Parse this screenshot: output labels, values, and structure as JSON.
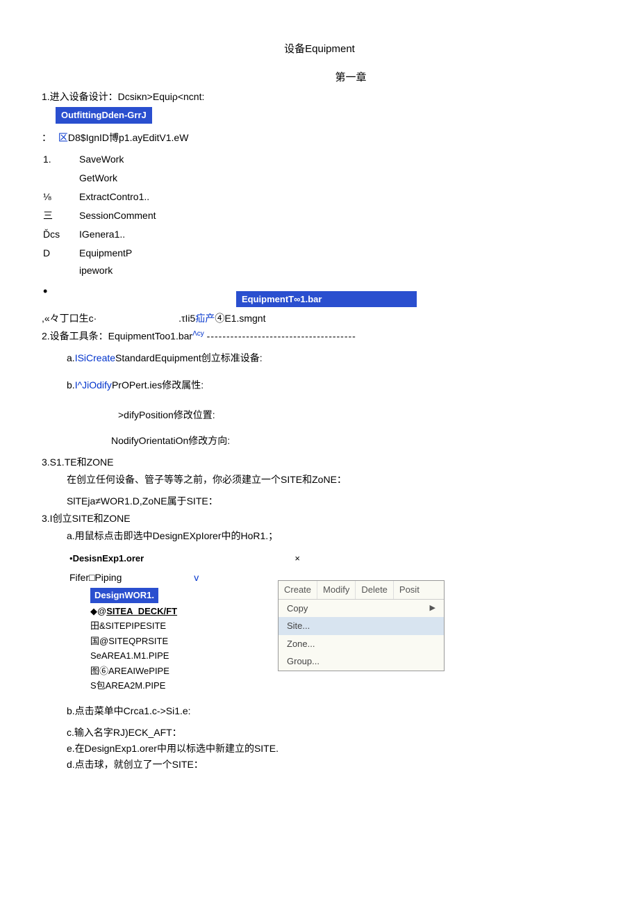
{
  "title": "设备Equipment",
  "chapter": "第一章",
  "step1": "1.进入设备设计：Dcsiκn>Equiρ<ncnt:",
  "box_outfitting": "OutfittingDden-GrrJ",
  "line_colon": "：",
  "line_area": "区",
  "line_d8": "D8$IgnID博p1.ayEditV1.eW",
  "left_col": {
    "r1": "1.",
    "r2": "⅛",
    "r3": "三",
    "r4": "Ďcs",
    "r5": "D",
    "r6": "•"
  },
  "right_col": {
    "r1a": "SaveWork",
    "r1b": "GetWork",
    "r2": "ExtractContro1..",
    "r3": "SessionComment",
    "r4": "IGenera1..",
    "r5a": "EquipmentP",
    "r5b": "ipework"
  },
  "box_toolbar": "EquipmentT∞1.bar",
  "line_cc": ",«々丁口生c·",
  "line_tli": ".τIi5",
  "line_pain": "疝产",
  "line_el": "④E1.smgnt",
  "step2_prefix": "2.设备工具条：EquipmentToo1.bar",
  "step2_sup": "Λcy",
  "dash_line": "--------------------------------------",
  "item_a_prefix": "a.",
  "item_a_blue": "ISiCreate",
  "item_a_rest": "StandardEquipment创立标准设备:",
  "item_b_prefix": "b.",
  "item_b_blue": "I^JiOdify",
  "item_b_rest": "PrOPert.ies修改属性:",
  "item_c": ">difyPosition修改位置:",
  "item_d": "NodifyOrientatiOn修改方向:",
  "sec3": "3.S1.TE和ZONE",
  "sec3_desc": "在创立任何设备、管子等等之前，你必须建立一个SITE和ZoNE：",
  "sec3_line2": "SlTEja≠WOR1.D,ZoNE属于SITE：",
  "sec31": "3.I创立SITE和ZONE",
  "sec31_a": "a.用鼠标点击即选中DesignEXpIorer中的HoR1.；",
  "explorer_title_bullet": "•",
  "explorer_title": "DesisnExp1.orer",
  "explorer_close": "×",
  "filter_label": "Fifer□Piping",
  "v_char": "v",
  "tree_blue": "DesignWOR1.",
  "tree_item1_prefix": "◆@",
  "tree_item1": "SITEA_DECK/FT",
  "tree_item2": "田&SITEPIPESITE",
  "tree_item3": "国@SITEQPRSITE",
  "tree_item4": "SeAREA1.M1.PIPE",
  "tree_item5": "图⑥AREAIWePIPE",
  "tree_item6": "S包AREA2M.PIPE",
  "menu_tabs": {
    "t1": "Create",
    "t2": "Modify",
    "t3": "Delete",
    "t4": "Posit"
  },
  "menu_items": {
    "copy": "Copy",
    "site": "Site...",
    "zone": "Zone...",
    "group": "Group..."
  },
  "below_b": "b.点击菜单中Crca1.c->Si1.e:",
  "below_c": "c.输入名字RJ)ECK_AFT：",
  "below_e": "e.在DesignExp1.orer中用以标选中新建立的SITE.",
  "below_d": "d.点击球，就创立了一个SITE："
}
